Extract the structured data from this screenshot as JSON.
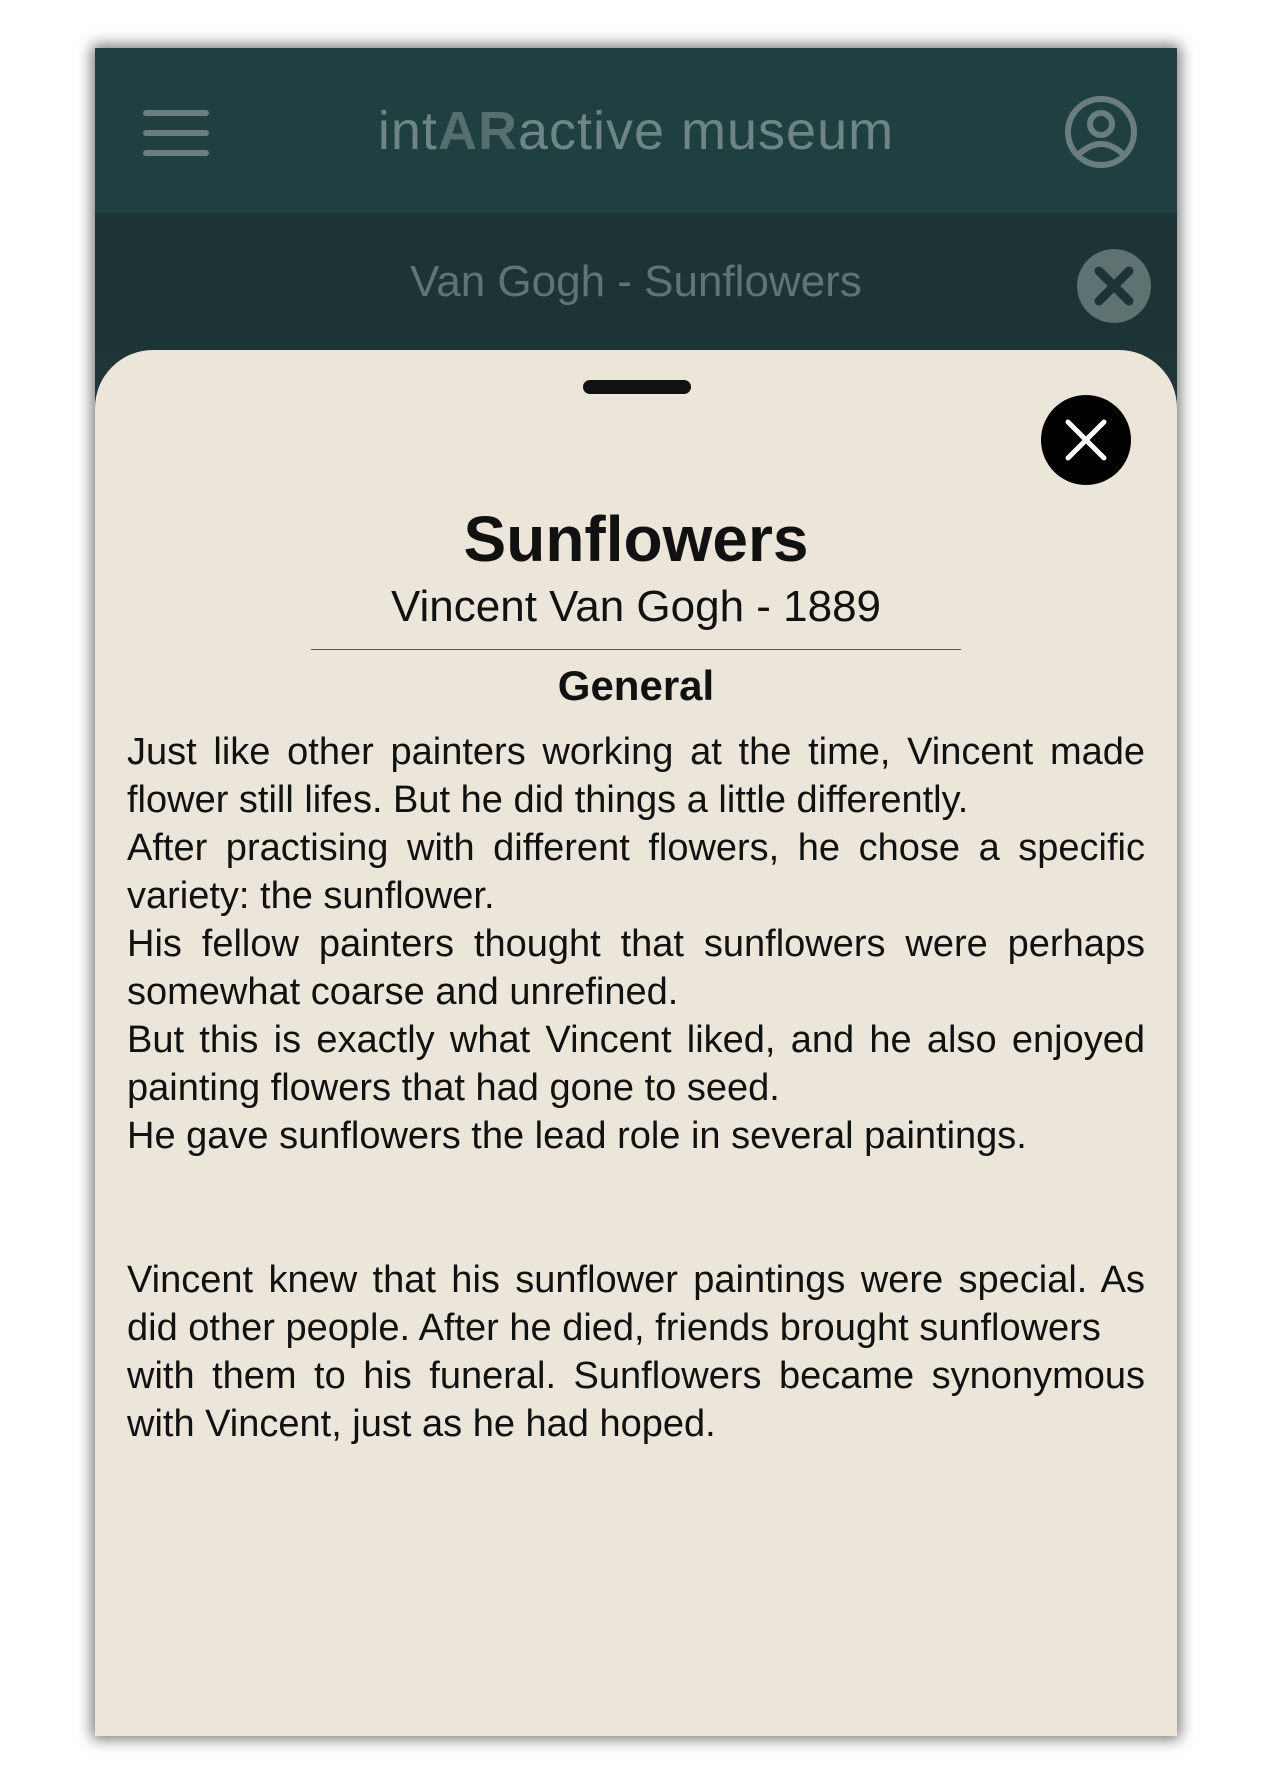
{
  "appbar": {
    "title_pre": "int",
    "title_bold": "AR",
    "title_post": "active museum"
  },
  "subbar": {
    "title": "Van Gogh - Sunflowers"
  },
  "sheet": {
    "title": "Sunflowers",
    "subtitle": "Vincent Van Gogh - 1889",
    "section": "General",
    "paragraph1": [
      "Just like other painters working at the time, Vincent made flower still lifes. But he did things a little differently.",
      "After practising with different flowers, he chose a specific variety: the sunflower.",
      "His fellow painters thought that sunflowers were perhaps somewhat coarse and unrefined.",
      "But this is exactly what Vincent liked, and he also enjoyed painting flowers that had gone to seed.",
      "He gave sunflowers the lead role in several paintings."
    ],
    "paragraph2": [
      "Vincent knew that his sunflower paintings were special. As did other people. After he died, friends brought sunflowers",
      "with them to his funeral. Sunflowers became synonymous with Vincent, just as he had hoped."
    ]
  },
  "colors": {
    "appbar_bg": "#203f41",
    "sheet_bg": "#ebe5da",
    "text": "#111111"
  }
}
